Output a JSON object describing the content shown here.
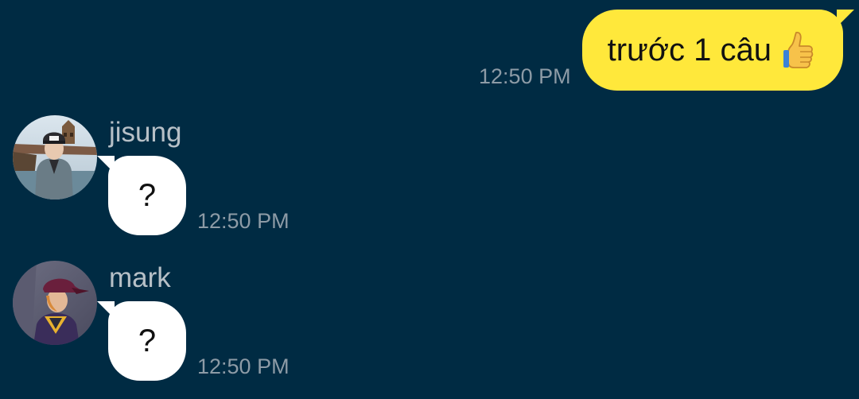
{
  "conversation": {
    "outgoing": {
      "text": "trước 1 câu",
      "emoji": "thumbs-up-icon",
      "time": "12:50 PM"
    },
    "incoming": [
      {
        "sender": "jisung",
        "avatar": "jisung-avatar",
        "text": "?",
        "time": "12:50 PM"
      },
      {
        "sender": "mark",
        "avatar": "mark-avatar",
        "text": "?",
        "time": "12:50 PM"
      }
    ]
  },
  "colors": {
    "background": "#002b43",
    "outgoing_bubble": "#ffe83b",
    "incoming_bubble": "#ffffff",
    "timestamp": "#8d9ba6",
    "sender_name": "#b7c0c7"
  }
}
